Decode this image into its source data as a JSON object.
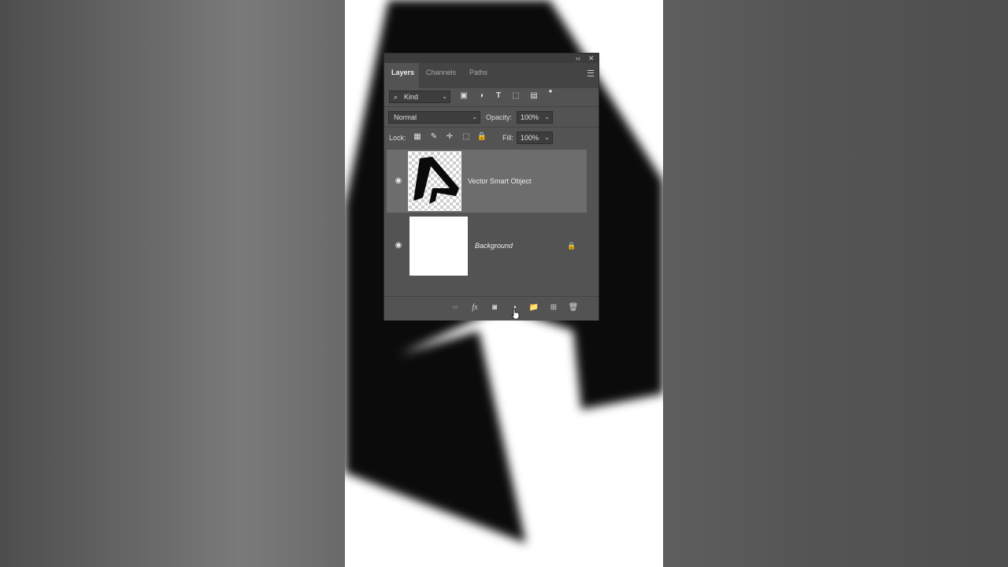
{
  "panel": {
    "titlebar": {
      "collapse_glyph": "‹‹",
      "close_glyph": "✕"
    },
    "tabs": [
      {
        "label": "Layers",
        "active": true
      },
      {
        "label": "Channels",
        "active": false
      },
      {
        "label": "Paths",
        "active": false
      }
    ],
    "filter": {
      "label": "Kind",
      "icon": "search-icon"
    },
    "filter_icons": [
      "image-filter-icon",
      "adjustment-filter-icon",
      "type-filter-icon",
      "shape-filter-icon",
      "smart-object-filter-icon",
      "filter-toggle-icon"
    ],
    "blend_mode": "Normal",
    "opacity": {
      "label": "Opacity:",
      "value": "100%"
    },
    "lock": {
      "label": "Lock:",
      "icons": [
        "lock-transparent-icon",
        "lock-image-icon",
        "lock-position-icon",
        "lock-artboard-icon",
        "lock-all-icon"
      ]
    },
    "fill": {
      "label": "Fill:",
      "value": "100%"
    },
    "layers": [
      {
        "name": "Vector Smart Object",
        "visible": true,
        "selected": true
      },
      {
        "name": "Background",
        "visible": true,
        "selected": false,
        "locked": true
      }
    ],
    "footer_icons": [
      "link-layers-icon",
      "fx-icon",
      "add-mask-icon",
      "adjustment-layer-icon",
      "new-group-icon",
      "new-layer-icon",
      "delete-icon"
    ],
    "fx_label": "fx"
  },
  "colors": {
    "panel_bg": "#535353",
    "selected_layer": "#6d6d6d",
    "tab_bar": "#444444"
  }
}
